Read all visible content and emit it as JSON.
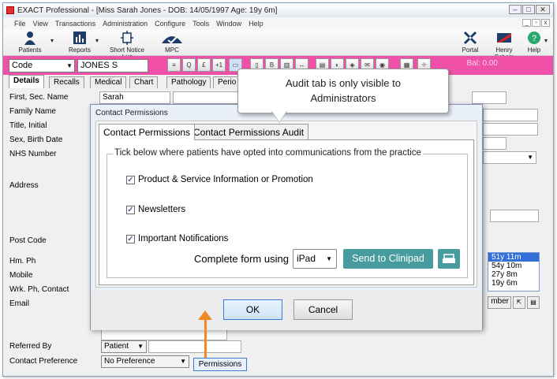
{
  "window": {
    "title": "EXACT Professional - [Miss Sarah Jones - DOB: 14/05/1997 Age: 19y 6m]"
  },
  "menu": [
    "File",
    "View",
    "Transactions",
    "Administration",
    "Configure",
    "Tools",
    "Window",
    "Help"
  ],
  "toolbar": {
    "patients": "Patients",
    "reports": "Reports",
    "short_notice": "Short Notice List",
    "mpc": "MPC",
    "portal": "Portal",
    "henry_schein": "Henry Schein",
    "help": "Help"
  },
  "search": {
    "mode": "Code",
    "value": "JONES S",
    "balance": "Bal: 0.00"
  },
  "tabs": [
    "Details",
    "Recalls",
    "Medical",
    "Chart",
    "Pathology",
    "Perio"
  ],
  "form": {
    "first_sec_name_label": "First, Sec. Name",
    "first_name_value": "Sarah",
    "family_name_label": "Family Name",
    "title_initial_label": "Title, Initial",
    "sex_birth_label": "Sex, Birth Date",
    "nhs_label": "NHS Number",
    "address_label": "Address",
    "post_code_label": "Post Code",
    "hm_ph_label": "Hm. Ph",
    "mobile_label": "Mobile",
    "wrk_ph_label": "Wrk. Ph, Contact",
    "email_label": "Email",
    "referred_by_label": "Referred By",
    "referred_by_value": "Patient",
    "contact_pref_label": "Contact Preference",
    "contact_pref_value": "No Preference",
    "permissions_button": "Permissions",
    "ages": [
      "51y 11m",
      "54y 10m",
      "27y 8m",
      "19y 6m"
    ],
    "number_button": "mber"
  },
  "dialog": {
    "title": "Contact Permissions",
    "tab_permissions": "Contact Permissions",
    "tab_audit": "Contact Permissions Audit",
    "legend": "Tick below where patients have opted into communications from the practice",
    "options": [
      {
        "label": "Product & Service Information or Promotion",
        "checked": true
      },
      {
        "label": "Newsletters",
        "checked": true
      },
      {
        "label": "Important Notifications",
        "checked": true
      }
    ],
    "complete_form_label": "Complete form using",
    "device_value": "iPad",
    "send_button": "Send to Clinipad",
    "ok_button": "OK",
    "cancel_button": "Cancel"
  },
  "callout": {
    "line1": "Audit tab is only visible to",
    "line2": "Administrators"
  },
  "colors": {
    "pink_bar": "#f050a8",
    "send_button": "#479c9d",
    "arrow": "#f08a24"
  }
}
